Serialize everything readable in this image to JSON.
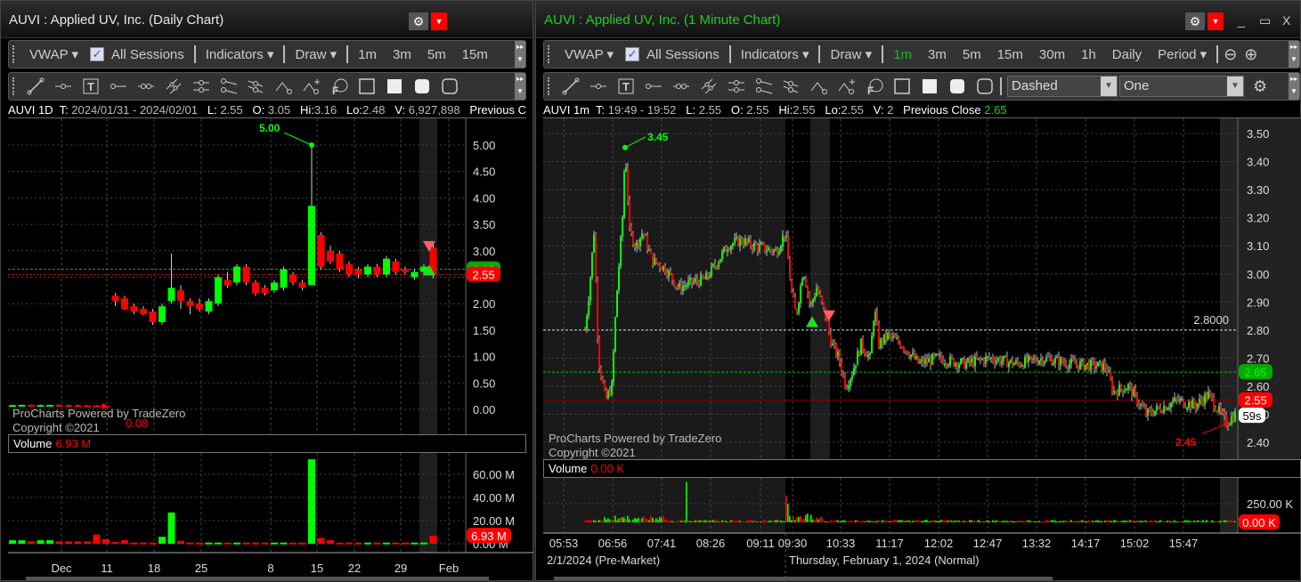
{
  "colors": {
    "up": "#00ff00",
    "down": "#ff0000",
    "bg": "#000000",
    "accent_green": "#1fd01f",
    "grid": "#555555"
  },
  "toolbar": {
    "vwap": "VWAP ▾",
    "all_sessions": "All Sessions",
    "indicators": "Indicators ▾",
    "draw": "Draw ▾",
    "period": "Period ▾",
    "check": "✓"
  },
  "left": {
    "title": "AUVI : Applied UV, Inc. (Daily Chart)",
    "timeframes": [
      "1m",
      "3m",
      "5m",
      "15m"
    ],
    "info": {
      "sym": "AUVI 1D",
      "t_label": "T:",
      "t": "2024/01/31 - 2024/02/01",
      "l_label": "L:",
      "l": "2.55",
      "o_label": "O:",
      "o": "3.05",
      "hi_label": "Hi:",
      "hi": "3.16",
      "lo_label": "Lo:",
      "lo": "2.48",
      "v_label": "V:",
      "v": "6,927,898",
      "prev": "Previous Close"
    },
    "watermark": [
      "ProCharts Powered by TradeZero",
      "Copyright ©2021"
    ],
    "volume_label": "Volume",
    "volume_value": "6.93 M",
    "high_annotation": "5.00",
    "low_annotation": "0.08",
    "price_tag": "2.55",
    "vol_tag": "6.93 M"
  },
  "right": {
    "title": "AUVI : Applied UV, Inc. (1 Minute Chart)",
    "timeframes": [
      "1m",
      "3m",
      "5m",
      "15m",
      "30m",
      "1h",
      "Daily"
    ],
    "line_style": "Dashed",
    "line_count": "One",
    "info": {
      "sym": "AUVI 1m",
      "t_label": "T:",
      "t": "19:49 - 19:52",
      "l_label": "L:",
      "l": "2.55",
      "o_label": "O:",
      "o": "2.55",
      "hi_label": "Hi:",
      "hi": "2.55",
      "lo_label": "Lo:",
      "lo": "2.55",
      "v_label": "V:",
      "v": "2",
      "prev_label": "Previous Close",
      "prev": "2.65"
    },
    "watermark": [
      "ProCharts Powered by TradeZero",
      "Copyright ©2021"
    ],
    "volume_label": "Volume",
    "volume_value": "0.00 K",
    "high_annotation": "3.45",
    "low_annotation": "2.45",
    "hline_label": "2.8000",
    "prev_close_tag": "2.65",
    "price_tag": "2.55",
    "timer_tag": "59s",
    "vol_tag": "0.00 K",
    "session_premarket": "2/1/2024 (Pre-Market)",
    "session_normal": "Thursday, February 1, 2024 (Normal)"
  },
  "chart_data": [
    {
      "type": "candlestick",
      "title": "AUVI Daily",
      "y_ticks": [
        "0.00",
        "0.50",
        "1.00",
        "1.50",
        "2.00",
        "2.50",
        "3.00",
        "3.50",
        "4.00",
        "4.50",
        "5.00"
      ],
      "ylim": [
        0,
        5.2
      ],
      "x_ticks": [
        "Dec",
        "11",
        "18",
        "25",
        "8",
        "15",
        "22",
        "29",
        "Feb"
      ],
      "hlines": [
        {
          "value": 2.65,
          "color": "#00c000"
        },
        {
          "value": 2.55,
          "color": "#c00000"
        }
      ],
      "ohlc": [
        [
          0.08,
          0.09,
          0.07,
          0.08
        ],
        [
          0.08,
          0.09,
          0.07,
          0.085
        ],
        [
          0.085,
          0.09,
          0.07,
          0.08
        ],
        [
          0.08,
          0.09,
          0.07,
          0.082
        ],
        [
          0.082,
          0.09,
          0.07,
          0.085
        ],
        [
          0.085,
          0.09,
          0.07,
          0.08
        ],
        [
          0.08,
          0.09,
          0.07,
          0.078
        ],
        [
          0.078,
          0.09,
          0.07,
          0.076
        ],
        [
          0.076,
          0.08,
          0.07,
          0.074
        ],
        [
          0.074,
          0.08,
          0.06,
          0.07
        ],
        [
          0.07,
          0.08,
          0.06,
          0.068
        ],
        [
          2.15,
          2.2,
          1.95,
          2.05
        ],
        [
          2.1,
          2.15,
          1.88,
          1.9
        ],
        [
          1.95,
          2.0,
          1.8,
          1.85
        ],
        [
          1.9,
          1.95,
          1.78,
          1.8
        ],
        [
          1.85,
          1.9,
          1.6,
          1.65
        ],
        [
          1.65,
          2.0,
          1.6,
          1.95
        ],
        [
          2.05,
          2.95,
          2.0,
          2.3
        ],
        [
          2.25,
          2.35,
          1.9,
          2.05
        ],
        [
          2.05,
          2.1,
          1.8,
          1.95
        ],
        [
          2.0,
          2.1,
          1.85,
          1.9
        ],
        [
          1.85,
          2.1,
          1.8,
          2.05
        ],
        [
          2.0,
          2.55,
          1.95,
          2.5
        ],
        [
          2.45,
          2.6,
          2.3,
          2.35
        ],
        [
          2.4,
          2.75,
          2.35,
          2.7
        ],
        [
          2.7,
          2.75,
          2.35,
          2.4
        ],
        [
          2.4,
          2.45,
          2.15,
          2.2
        ],
        [
          2.3,
          2.35,
          2.15,
          2.2
        ],
        [
          2.25,
          2.45,
          2.2,
          2.4
        ],
        [
          2.3,
          2.7,
          2.25,
          2.65
        ],
        [
          2.55,
          2.6,
          2.35,
          2.4
        ],
        [
          2.4,
          2.45,
          2.25,
          2.3
        ],
        [
          2.35,
          5.0,
          2.5,
          3.85
        ],
        [
          3.3,
          3.35,
          2.65,
          2.7
        ],
        [
          3.0,
          3.1,
          2.75,
          2.8
        ],
        [
          2.95,
          3.0,
          2.6,
          2.65
        ],
        [
          2.75,
          2.8,
          2.5,
          2.55
        ],
        [
          2.65,
          2.7,
          2.48,
          2.55
        ],
        [
          2.55,
          2.75,
          2.5,
          2.7
        ],
        [
          2.7,
          2.75,
          2.5,
          2.55
        ],
        [
          2.55,
          2.9,
          2.5,
          2.85
        ],
        [
          2.8,
          2.85,
          2.55,
          2.6
        ],
        [
          2.65,
          2.7,
          2.55,
          2.6
        ],
        [
          2.5,
          2.65,
          2.45,
          2.6
        ],
        [
          2.6,
          2.75,
          2.55,
          2.7
        ],
        [
          3.05,
          3.16,
          2.48,
          2.55
        ]
      ],
      "volume_m": [
        3,
        3,
        2,
        3,
        3,
        2,
        2,
        2,
        2,
        8,
        4,
        1.5,
        3,
        1,
        1,
        1,
        6,
        27,
        2.5,
        1,
        1,
        1,
        1,
        1,
        1,
        1,
        1,
        1,
        1,
        1,
        1,
        1,
        73,
        5,
        3,
        1,
        1,
        1,
        1,
        1,
        1,
        1,
        1,
        1,
        1,
        6.93
      ],
      "volume_ticks": [
        "0.00 M",
        "20.00 M",
        "40.00 M",
        "60.00 M"
      ]
    },
    {
      "type": "candlestick",
      "title": "AUVI 1 Minute",
      "y_ticks": [
        "2.40",
        "2.50",
        "2.60",
        "2.70",
        "2.80",
        "2.90",
        "3.00",
        "3.10",
        "3.20",
        "3.30",
        "3.40",
        "3.50"
      ],
      "ylim": [
        2.35,
        3.55
      ],
      "x_ticks": [
        "05:53",
        "06:56",
        "07:41",
        "08:26",
        "09:11",
        "09:30",
        "10:33",
        "11:17",
        "12:02",
        "12:47",
        "13:32",
        "14:17",
        "15:02",
        "15:47"
      ],
      "hlines": [
        {
          "value": 2.8,
          "color": "#dddddd",
          "label": "2.8000"
        },
        {
          "value": 2.65,
          "color": "#00c000"
        },
        {
          "value": 2.55,
          "color": "#c00000"
        }
      ],
      "price_path": [
        [
          0,
          2.8
        ],
        [
          5,
          2.95
        ],
        [
          10,
          3.15
        ],
        [
          15,
          2.7
        ],
        [
          23,
          2.55
        ],
        [
          30,
          2.6
        ],
        [
          35,
          2.9
        ],
        [
          42,
          3.2
        ],
        [
          45,
          3.45
        ],
        [
          50,
          3.15
        ],
        [
          57,
          3.1
        ],
        [
          65,
          3.15
        ],
        [
          75,
          3.05
        ],
        [
          90,
          3.02
        ],
        [
          105,
          2.95
        ],
        [
          120,
          2.97
        ],
        [
          135,
          2.98
        ],
        [
          150,
          3.05
        ],
        [
          160,
          3.1
        ],
        [
          175,
          3.12
        ],
        [
          190,
          3.1
        ],
        [
          215,
          3.08
        ],
        [
          225,
          3.15
        ],
        [
          231,
          2.95
        ],
        [
          237,
          2.85
        ],
        [
          245,
          3.02
        ],
        [
          253,
          2.88
        ],
        [
          260,
          2.95
        ],
        [
          270,
          2.85
        ],
        [
          277,
          2.75
        ],
        [
          285,
          2.7
        ],
        [
          293,
          2.6
        ],
        [
          300,
          2.65
        ],
        [
          310,
          2.75
        ],
        [
          320,
          2.7
        ],
        [
          325,
          2.88
        ],
        [
          330,
          2.75
        ],
        [
          340,
          2.78
        ],
        [
          355,
          2.75
        ],
        [
          375,
          2.68
        ],
        [
          395,
          2.7
        ],
        [
          425,
          2.68
        ],
        [
          455,
          2.7
        ],
        [
          485,
          2.68
        ],
        [
          515,
          2.7
        ],
        [
          545,
          2.68
        ],
        [
          585,
          2.67
        ],
        [
          593,
          2.58
        ],
        [
          610,
          2.6
        ],
        [
          630,
          2.5
        ],
        [
          645,
          2.52
        ],
        [
          665,
          2.55
        ],
        [
          685,
          2.53
        ],
        [
          700,
          2.57
        ],
        [
          710,
          2.52
        ],
        [
          720,
          2.47
        ],
        [
          730,
          2.5
        ]
      ],
      "volume_ticks": [
        "250.00 K"
      ]
    }
  ]
}
